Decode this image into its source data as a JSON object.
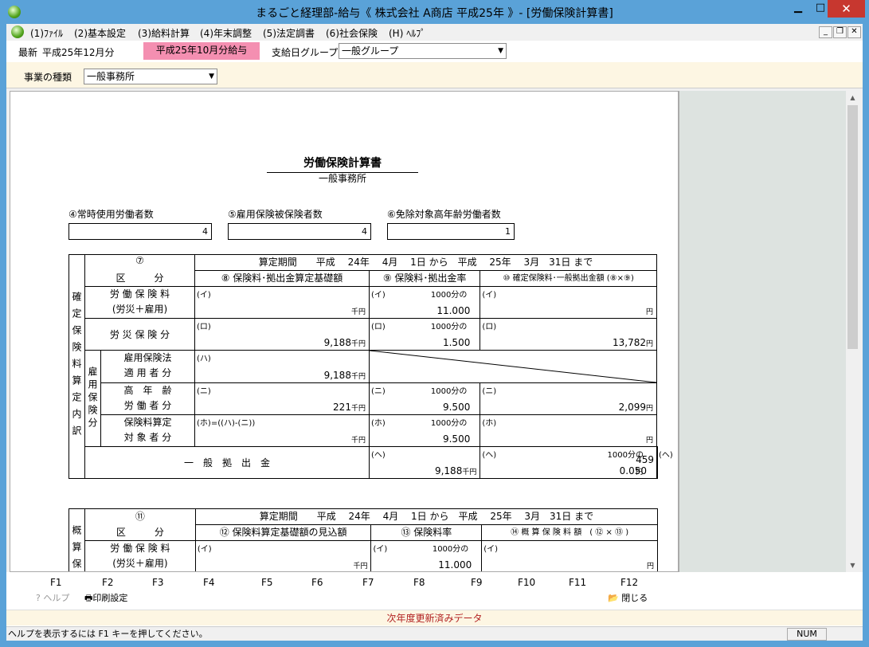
{
  "window": {
    "title": "まるごと経理部-給与《 株式会社  A商店  平成25年 》- [労働保険計算書]"
  },
  "menu": [
    "(1)ﾌｧｲﾙ",
    "(2)基本設定",
    "(3)給料計算",
    "(4)年末調整",
    "(5)法定調書",
    "(6)社会保険",
    "(H) ﾍﾙﾌﾟ"
  ],
  "toolbar": {
    "latest_label": "最新",
    "latest_value": "平成25年12月分",
    "current_payroll": "平成25年10月分給与",
    "pay_group_label": "支給日グループ",
    "pay_group_value": "一般グループ",
    "business_type_label": "事業の種類",
    "business_type_value": "一般事務所"
  },
  "doc": {
    "title": "労働保険計算書",
    "subtitle": "一般事務所",
    "field4_label": "④常時使用労働者数",
    "field4_value": "4",
    "field5_label": "⑤雇用保険被保険者数",
    "field5_value": "4",
    "field6_label": "⑥免除対象高年齢労働者数",
    "field6_value": "1",
    "t1": {
      "num": "⑦",
      "kubun": "区　　　分",
      "side": "確定保険料算定内訳",
      "period": "算定期間　　平成　 24年　 4月　 1日 から　平成　 25年　 3月　31日 まで",
      "col8": "⑧ 保険料･拠出金算定基礎額",
      "col9": "⑨ 保険料･拠出金率",
      "col10": "⑩ 確定保険料･一般拠出金額 (⑧×⑨)",
      "koyo_side": "雇用保険分",
      "rows": [
        {
          "label1": "労 働 保 険 料",
          "label2": "(労災＋雇用)",
          "c8": "(イ)",
          "v8": "",
          "c9": "(イ)",
          "r9": "1000分の",
          "v9": "11.000",
          "c10": "(イ)",
          "v10": ""
        },
        {
          "label1": "労 災 保 険 分",
          "label2": "",
          "c8": "(ロ)",
          "v8": "9,188",
          "c9": "(ロ)",
          "r9": "1000分の",
          "v9": "1.500",
          "c10": "(ロ)",
          "v10": "13,782"
        },
        {
          "label1": "雇用保険法",
          "label2": "適 用 者 分",
          "c8": "(ハ)",
          "v8": "9,188",
          "c9": "",
          "r9": "",
          "v9": "",
          "c10": "",
          "v10": ""
        },
        {
          "label1": "高　年　齢",
          "label2": "労 働 者 分",
          "c8": "(ニ)",
          "v8": "221",
          "c9": "(ニ)",
          "r9": "1000分の",
          "v9": "9.500",
          "c10": "(ニ)",
          "v10": "2,099"
        },
        {
          "label1": "保険料算定",
          "label2": "対 象 者 分",
          "c8": "(ホ)=((ハ)-(ニ))",
          "v8": "",
          "c9": "(ホ)",
          "r9": "1000分の",
          "v9": "9.500",
          "c10": "(ホ)",
          "v10": ""
        },
        {
          "label1": "一　般　拠　出　金",
          "label2": "",
          "c8": "(ヘ)",
          "v8": "9,188",
          "c9": "(ヘ)",
          "r9": "1000分の",
          "v9": "0.050",
          "c10": "(ヘ)",
          "v10": "459"
        }
      ]
    },
    "t2": {
      "num": "⑪",
      "kubun": "区　　　分",
      "side": "概算保",
      "period": "算定期間　　平成　 24年　 4月　 1日 から　平成　 25年　 3月　31日 まで",
      "col12": "⑫ 保険料算定基礎額の見込額",
      "col13": "⑬ 保険料率",
      "col14": "⑭ 概 算 保 険 料 額　( ⑫ × ⑬ )",
      "rows": [
        {
          "label1": "労 働 保 険 料",
          "label2": "(労災＋雇用)",
          "c12": "(イ)",
          "c13": "(イ)",
          "r13": "1000分の",
          "v13": "11.000",
          "c14": "(イ)"
        }
      ]
    },
    "unit_sen": "千円",
    "unit_en": "円"
  },
  "fkeys": [
    "F1",
    "F2",
    "F3",
    "F4",
    "F5",
    "F6",
    "F7",
    "F8",
    "F9",
    "F10",
    "F11",
    "F12"
  ],
  "fkey_actions": {
    "help": "ヘルプ",
    "print": "印刷設定",
    "close": "閉じる"
  },
  "status": {
    "message": "次年度更新済みデータ",
    "help_text": "ヘルプを表示するには F1 キーを押してください。",
    "num": "NUM"
  }
}
